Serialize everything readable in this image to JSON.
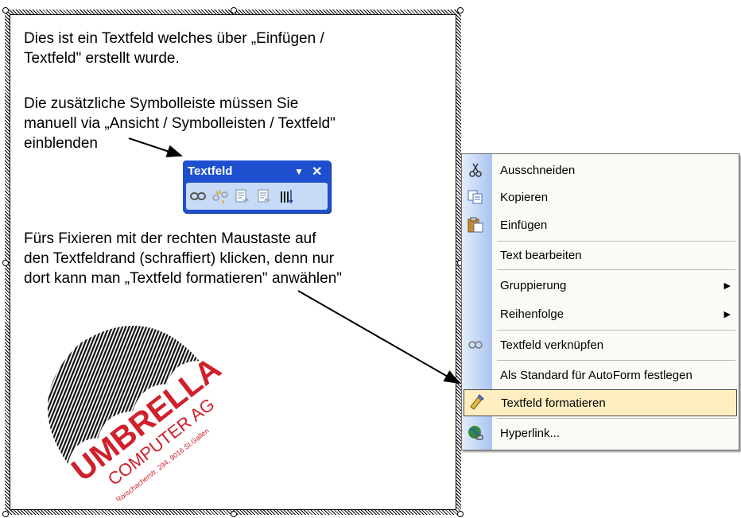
{
  "textbox": {
    "para1": "Dies ist ein Textfeld welches über „Einfügen /\nTextfeld\" erstellt wurde.",
    "para2": "Die zusätzliche Symbolleiste müssen Sie\nmanuell via „Ansicht / Symbolleisten / Textfeld\"\neinblenden",
    "para3": "Fürs Fixieren mit der rechten Maustaste auf\nden Textfeldrand (schraffiert) klicken, denn nur\ndort kann man „Textfeld formatieren\" anwählen\""
  },
  "toolbar": {
    "title": "Textfeld",
    "dropdown": "▼",
    "close": "✕",
    "buttons": [
      "link-icon",
      "unlink-icon",
      "previous-textbox-icon",
      "next-textbox-icon",
      "text-direction-icon"
    ]
  },
  "logo": {
    "name": "UMBRELLA",
    "line2": "COMPUTER AG",
    "line3": "Rorschacherstr. 294, 9016 St.Gallen"
  },
  "context_menu": {
    "items": [
      {
        "label": "Ausschneiden",
        "icon": "scissors-icon"
      },
      {
        "label": "Kopieren",
        "icon": "copy-icon"
      },
      {
        "label": "Einfügen",
        "icon": "paste-icon"
      },
      {
        "label": "Text bearbeiten",
        "icon": ""
      },
      {
        "label": "Gruppierung",
        "icon": "",
        "submenu": "▶"
      },
      {
        "label": "Reihenfolge",
        "icon": "",
        "submenu": "▶"
      },
      {
        "label": "Textfeld verknüpfen",
        "icon": "link-icon"
      },
      {
        "label": "Als Standard für AutoForm festlegen",
        "icon": ""
      },
      {
        "label": "Textfeld formatieren",
        "icon": "format-textbox-icon",
        "highlighted": true
      },
      {
        "label": "Hyperlink...",
        "icon": "hyperlink-globe-icon"
      }
    ]
  },
  "colors": {
    "toolbar_blue": "#1e4fcf",
    "menu_highlight": "#ffeec2",
    "logo_red": "#d0202c"
  }
}
